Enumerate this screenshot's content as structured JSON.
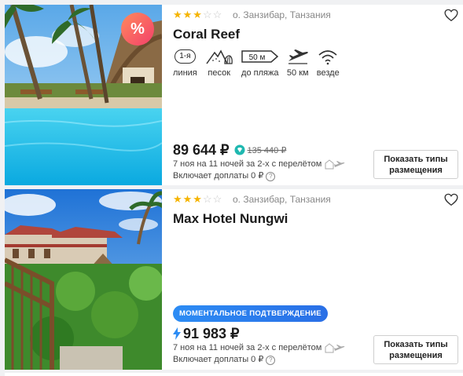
{
  "hotels": [
    {
      "stars_filled": 3,
      "stars_total": 5,
      "stars_on": "★★★",
      "stars_off": "☆☆",
      "location": "о. Занзибар, Танзания",
      "name": "Coral Reef",
      "discount_badge": "%",
      "features": {
        "line_value": "1-я",
        "line_label": "линия",
        "beach_label": "песок",
        "distance_value": "50 м",
        "distance_label": "до пляжа",
        "airport_label": "50 км",
        "wifi_label": "везде"
      },
      "price": "89 644 ₽",
      "old_price": "135 440 ₽",
      "trip_info": "7 ноя на 11 ночей за 2-х с перелётом",
      "included": "Включает доплаты 0 ₽",
      "button_label": "Показать типы размещения",
      "photo_icon": "pool-palms-photo"
    },
    {
      "stars_filled": 3,
      "stars_total": 5,
      "stars_on": "★★★",
      "stars_off": "☆☆",
      "location": "о. Занзибар, Танзания",
      "name": "Max Hotel Nungwi",
      "instant_badge": "МОМЕНТАЛЬНОЕ ПОДТВЕРЖДЕНИЕ",
      "price": "91 983 ₽",
      "trip_info": "7 ноя на 11 ночей за 2-х с перелётом",
      "included": "Включает доплаты 0 ₽",
      "button_label": "Показать типы размещения",
      "photo_icon": "hotel-garden-photo"
    }
  ],
  "colors": {
    "star": "#f5b400",
    "instant_badge": "#2c8cf4",
    "discount_badge": "#f3406b",
    "diamond": "#1fb8b0",
    "bolt": "#2c8cf4"
  }
}
